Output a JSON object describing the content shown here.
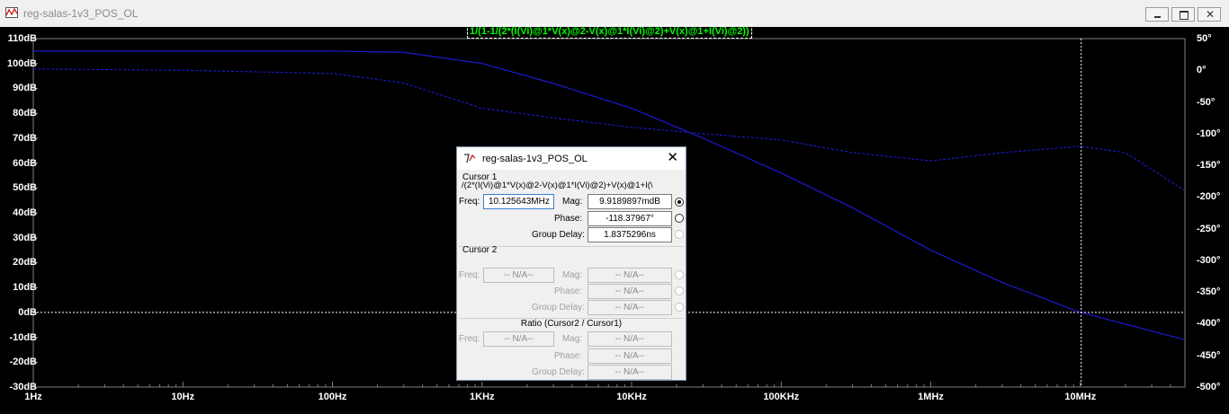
{
  "window": {
    "title": "reg-salas-1v3_POS_OL",
    "minimize_icon": "minimize-icon",
    "maximize_icon": "maximize-icon",
    "close_icon": "close-icon"
  },
  "plot": {
    "trace_expression": "1/(1-1/(2*(I(Vi)@1*V(x)@2-V(x)@1*I(Vi)@2)+V(x)@1+I(Vi)@2))",
    "trace_color": "#1a1ad0",
    "background": "#000000",
    "cursor_line_color": "#ffffff"
  },
  "chart_data": {
    "type": "line",
    "xscale": "log",
    "xlim": [
      "1Hz",
      "50MHz"
    ],
    "x_ticks": [
      "1Hz",
      "10Hz",
      "100Hz",
      "1KHz",
      "10KHz",
      "100KHz",
      "1MHz",
      "10MHz"
    ],
    "ylim_left": [
      -30,
      110
    ],
    "y_ticks_left": [
      "110dB",
      "100dB",
      "90dB",
      "80dB",
      "70dB",
      "60dB",
      "50dB",
      "40dB",
      "30dB",
      "20dB",
      "10dB",
      "0dB",
      "-10dB",
      "-20dB",
      "-30dB"
    ],
    "ylim_right": [
      -500,
      50
    ],
    "y_ticks_right": [
      "50°",
      "0°",
      "-50°",
      "-100°",
      "-150°",
      "-200°",
      "-250°",
      "-300°",
      "-350°",
      "-400°",
      "-450°",
      "-500°"
    ],
    "series": [
      {
        "axis": "left",
        "style": "solid",
        "x": [
          1,
          100,
          300,
          1000,
          3000,
          10000,
          30000,
          100000,
          300000,
          1000000,
          3000000,
          10000000,
          50000000
        ],
        "y": [
          105,
          105,
          104.5,
          100,
          92,
          82,
          70,
          56,
          42,
          25,
          12,
          0,
          -11
        ]
      },
      {
        "axis": "right",
        "style": "dashed",
        "x": [
          1,
          10,
          100,
          300,
          1000,
          3000,
          10000,
          30000,
          100000,
          300000,
          1000000,
          3000000,
          10000000,
          20000000,
          50000000
        ],
        "y": [
          2,
          0,
          -5,
          -20,
          -60,
          -75,
          -90,
          -100,
          -110,
          -130,
          -143,
          -130,
          -120,
          -130,
          -190
        ]
      }
    ],
    "cursor": {
      "x": 10125643,
      "y_left": 0
    }
  },
  "dialog": {
    "title": "reg-salas-1v3_POS_OL",
    "cursor1": {
      "heading": "Cursor 1",
      "expression": "/(2*(I(Vi)@1*V(x)@2-V(x)@1*I(Vi)@2)+V(x)@1+I(\\",
      "freq_label": "Freq:",
      "freq_value": "10.125643MHz",
      "mag_label": "Mag:",
      "mag_value": "9.9189897mdB",
      "phase_label": "Phase:",
      "phase_value": "-118.37967°",
      "gd_label": "Group Delay:",
      "gd_value": "1.8375296ns"
    },
    "cursor2": {
      "heading": "Cursor 2",
      "freq_label": "Freq:",
      "freq_value": "-- N/A--",
      "mag_label": "Mag:",
      "mag_value": "-- N/A--",
      "phase_label": "Phase:",
      "phase_value": "-- N/A--",
      "gd_label": "Group Delay:",
      "gd_value": "-- N/A--"
    },
    "ratio": {
      "heading": "Ratio (Cursor2 / Cursor1)",
      "freq_label": "Freq:",
      "freq_value": "-- N/A--",
      "mag_label": "Mag:",
      "mag_value": "-- N/A--",
      "phase_label": "Phase:",
      "phase_value": "-- N/A--",
      "gd_label": "Group Delay:",
      "gd_value": "-- N/A--"
    }
  }
}
